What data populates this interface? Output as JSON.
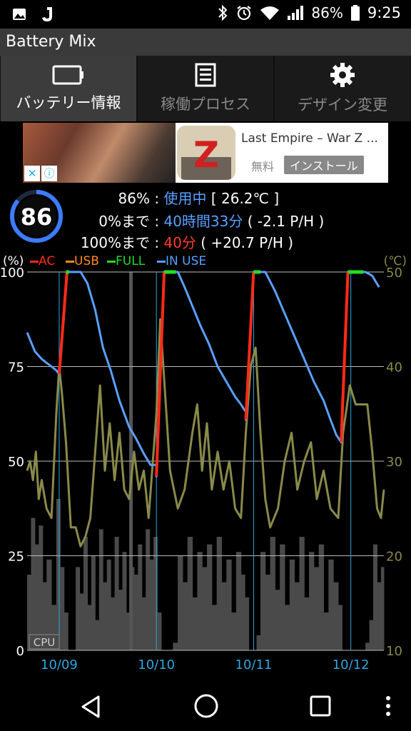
{
  "status_bar": {
    "battery_percent": "86%",
    "time": "9:25",
    "icons": [
      "image-icon",
      "j-app-icon",
      "bluetooth-icon",
      "alarm-icon",
      "wifi-icon",
      "signal-icon",
      "battery-icon"
    ]
  },
  "app": {
    "title": "Battery Mix"
  },
  "tabs": [
    {
      "label": "バッテリー情報",
      "icon": "battery-icon",
      "active": true
    },
    {
      "label": "稼働プロセス",
      "icon": "list-icon",
      "active": false
    },
    {
      "label": "デザイン変更",
      "icon": "gear-icon",
      "active": false
    }
  ],
  "ad": {
    "title": "Last Empire – War Z ...",
    "price": "無料",
    "install_label": "インストール",
    "app_icon_letter": "Z"
  },
  "battery": {
    "level_display": "86",
    "level": 86,
    "percent_text": "86%",
    "separator": ":",
    "status": "使用中",
    "temperature": "[ 26.2℃ ]",
    "to_empty_label": "0%まで",
    "to_empty_time": "40時間33分",
    "to_empty_rate": "( -2.1 P/H )",
    "to_full_label": "100%まで",
    "to_full_time": "40分",
    "to_full_rate": "( +20.7 P/H )"
  },
  "legend": {
    "left_unit": "(%)",
    "right_unit": "(℃)",
    "items": [
      {
        "label": "AC",
        "color": "#ff2a1a"
      },
      {
        "label": "USB",
        "color": "#ff8a20"
      },
      {
        "label": "FULL",
        "color": "#22dd22"
      },
      {
        "label": "IN USE",
        "color": "#5aa0ff"
      }
    ]
  },
  "chart_data": {
    "type": "line",
    "x_tick_labels": [
      "10/09",
      "10/10",
      "10/11",
      "10/12"
    ],
    "y_left_ticks": [
      0,
      25,
      50,
      75,
      100
    ],
    "y_right_ticks": [
      10,
      20,
      30,
      40,
      50
    ],
    "ylim_left": [
      0,
      100
    ],
    "ylim_right": [
      10,
      50
    ],
    "corner_label": "CPU",
    "colors": {
      "battery": "#5aa0ff",
      "charging": "#ff2a1a",
      "full": "#22dd22",
      "temperature": "#8a8a4a",
      "cpu": "#4a4a4a"
    },
    "x_domain": [
      0,
      3.67
    ],
    "battery_series": [
      [
        0.0,
        84
      ],
      [
        0.08,
        79
      ],
      [
        0.15,
        77
      ],
      [
        0.25,
        75
      ],
      [
        0.3,
        74
      ],
      [
        0.33,
        73
      ],
      [
        0.33,
        73
      ],
      [
        0.41,
        100
      ],
      [
        0.45,
        100
      ],
      [
        0.55,
        100
      ],
      [
        0.62,
        97
      ],
      [
        0.7,
        90
      ],
      [
        0.78,
        80
      ],
      [
        0.86,
        74
      ],
      [
        0.95,
        66
      ],
      [
        1.05,
        59
      ],
      [
        1.12,
        56
      ],
      [
        1.2,
        52
      ],
      [
        1.27,
        49
      ],
      [
        1.33,
        49
      ],
      [
        1.33,
        46
      ],
      [
        1.41,
        100
      ],
      [
        1.45,
        100
      ],
      [
        1.55,
        100
      ],
      [
        1.62,
        96
      ],
      [
        1.7,
        91
      ],
      [
        1.78,
        86
      ],
      [
        1.87,
        81
      ],
      [
        1.96,
        75
      ],
      [
        2.05,
        71
      ],
      [
        2.14,
        67
      ],
      [
        2.2,
        65
      ],
      [
        2.25,
        63
      ],
      [
        2.25,
        61
      ],
      [
        2.33,
        100
      ],
      [
        2.37,
        100
      ],
      [
        2.45,
        100
      ],
      [
        2.55,
        95
      ],
      [
        2.65,
        89
      ],
      [
        2.75,
        83
      ],
      [
        2.85,
        77
      ],
      [
        2.95,
        71
      ],
      [
        3.05,
        66
      ],
      [
        3.12,
        61
      ],
      [
        3.18,
        57
      ],
      [
        3.23,
        55
      ],
      [
        3.23,
        55
      ],
      [
        3.3,
        100
      ],
      [
        3.34,
        100
      ],
      [
        3.48,
        100
      ],
      [
        3.55,
        99
      ],
      [
        3.62,
        96
      ]
    ],
    "charging_segments": [
      [
        [
          0.33,
          73
        ],
        [
          0.41,
          100
        ]
      ],
      [
        [
          1.33,
          46
        ],
        [
          1.41,
          100
        ]
      ],
      [
        [
          2.25,
          61
        ],
        [
          2.33,
          100
        ]
      ],
      [
        [
          3.23,
          55
        ],
        [
          3.3,
          100
        ]
      ]
    ],
    "full_segments": [
      [
        [
          0.4,
          100
        ],
        [
          0.43,
          100
        ]
      ],
      [
        [
          1.41,
          100
        ],
        [
          1.53,
          100
        ]
      ],
      [
        [
          2.33,
          100
        ],
        [
          2.4,
          100
        ]
      ],
      [
        [
          3.3,
          100
        ],
        [
          3.46,
          100
        ]
      ]
    ],
    "temperature_series": [
      [
        0.0,
        29
      ],
      [
        0.03,
        30
      ],
      [
        0.06,
        28
      ],
      [
        0.09,
        31
      ],
      [
        0.12,
        26
      ],
      [
        0.15,
        28
      ],
      [
        0.2,
        25
      ],
      [
        0.25,
        24
      ],
      [
        0.3,
        35
      ],
      [
        0.33,
        40
      ],
      [
        0.36,
        37
      ],
      [
        0.4,
        32
      ],
      [
        0.45,
        23
      ],
      [
        0.5,
        23
      ],
      [
        0.55,
        21
      ],
      [
        0.6,
        22
      ],
      [
        0.65,
        24
      ],
      [
        0.7,
        31
      ],
      [
        0.75,
        38
      ],
      [
        0.8,
        29
      ],
      [
        0.85,
        34
      ],
      [
        0.9,
        28
      ],
      [
        0.95,
        33
      ],
      [
        1.0,
        27
      ],
      [
        1.05,
        26
      ],
      [
        1.1,
        31
      ],
      [
        1.15,
        27
      ],
      [
        1.2,
        29
      ],
      [
        1.25,
        24
      ],
      [
        1.33,
        35
      ],
      [
        1.37,
        45
      ],
      [
        1.42,
        37
      ],
      [
        1.47,
        29
      ],
      [
        1.55,
        25
      ],
      [
        1.62,
        27
      ],
      [
        1.7,
        33
      ],
      [
        1.75,
        36
      ],
      [
        1.8,
        29
      ],
      [
        1.85,
        34
      ],
      [
        1.9,
        27
      ],
      [
        1.96,
        31
      ],
      [
        2.02,
        27
      ],
      [
        2.08,
        30
      ],
      [
        2.14,
        25
      ],
      [
        2.2,
        24
      ],
      [
        2.25,
        33
      ],
      [
        2.3,
        40
      ],
      [
        2.35,
        42
      ],
      [
        2.4,
        33
      ],
      [
        2.45,
        26
      ],
      [
        2.5,
        23
      ],
      [
        2.58,
        25
      ],
      [
        2.65,
        30
      ],
      [
        2.72,
        33
      ],
      [
        2.78,
        27
      ],
      [
        2.85,
        30
      ],
      [
        2.92,
        32
      ],
      [
        2.98,
        26
      ],
      [
        3.05,
        29
      ],
      [
        3.12,
        25
      ],
      [
        3.2,
        24
      ],
      [
        3.25,
        33
      ],
      [
        3.32,
        38
      ],
      [
        3.38,
        36
      ],
      [
        3.45,
        36
      ],
      [
        3.5,
        36
      ],
      [
        3.55,
        31
      ],
      [
        3.6,
        25
      ],
      [
        3.64,
        24
      ],
      [
        3.67,
        27
      ]
    ],
    "cpu_series": [
      [
        0.0,
        20
      ],
      [
        0.04,
        35
      ],
      [
        0.08,
        28
      ],
      [
        0.12,
        33
      ],
      [
        0.16,
        18
      ],
      [
        0.2,
        24
      ],
      [
        0.25,
        12
      ],
      [
        0.3,
        40
      ],
      [
        0.34,
        22
      ],
      [
        0.38,
        10
      ],
      [
        0.42,
        0
      ],
      [
        0.46,
        0
      ],
      [
        0.5,
        22
      ],
      [
        0.54,
        15
      ],
      [
        0.58,
        30
      ],
      [
        0.62,
        12
      ],
      [
        0.66,
        25
      ],
      [
        0.7,
        8
      ],
      [
        0.74,
        32
      ],
      [
        0.78,
        18
      ],
      [
        0.82,
        24
      ],
      [
        0.86,
        14
      ],
      [
        0.9,
        30
      ],
      [
        0.94,
        16
      ],
      [
        0.98,
        26
      ],
      [
        1.02,
        10
      ],
      [
        1.06,
        22
      ],
      [
        1.1,
        20
      ],
      [
        1.14,
        28
      ],
      [
        1.18,
        14
      ],
      [
        1.22,
        32
      ],
      [
        1.26,
        24
      ],
      [
        1.3,
        30
      ],
      [
        1.34,
        10
      ],
      [
        1.38,
        0
      ],
      [
        1.42,
        0
      ],
      [
        1.46,
        0
      ],
      [
        1.5,
        2
      ],
      [
        1.55,
        25
      ],
      [
        1.6,
        18
      ],
      [
        1.65,
        30
      ],
      [
        1.7,
        14
      ],
      [
        1.75,
        26
      ],
      [
        1.8,
        22
      ],
      [
        1.85,
        28
      ],
      [
        1.9,
        12
      ],
      [
        1.95,
        30
      ],
      [
        2.0,
        18
      ],
      [
        2.05,
        24
      ],
      [
        2.1,
        10
      ],
      [
        2.15,
        26
      ],
      [
        2.2,
        20
      ],
      [
        2.24,
        14
      ],
      [
        2.28,
        0
      ],
      [
        2.32,
        0
      ],
      [
        2.36,
        4
      ],
      [
        2.4,
        26
      ],
      [
        2.45,
        20
      ],
      [
        2.5,
        30
      ],
      [
        2.55,
        16
      ],
      [
        2.6,
        28
      ],
      [
        2.65,
        12
      ],
      [
        2.7,
        24
      ],
      [
        2.75,
        18
      ],
      [
        2.8,
        30
      ],
      [
        2.85,
        14
      ],
      [
        2.9,
        26
      ],
      [
        2.95,
        22
      ],
      [
        3.0,
        28
      ],
      [
        3.05,
        10
      ],
      [
        3.1,
        24
      ],
      [
        3.15,
        18
      ],
      [
        3.2,
        12
      ],
      [
        3.24,
        0
      ],
      [
        3.28,
        0
      ],
      [
        3.35,
        0
      ],
      [
        3.42,
        0
      ],
      [
        3.48,
        2
      ],
      [
        3.52,
        8
      ],
      [
        3.56,
        28
      ],
      [
        3.6,
        18
      ],
      [
        3.64,
        22
      ],
      [
        3.67,
        15
      ]
    ],
    "cpu_spike": [
      1.05,
      100
    ],
    "day_markers": [
      0.33,
      1.33,
      2.33,
      3.33
    ]
  },
  "nav": {
    "back": "back-icon",
    "home": "home-icon",
    "recents": "recents-icon",
    "menu": "overflow-menu-icon"
  }
}
